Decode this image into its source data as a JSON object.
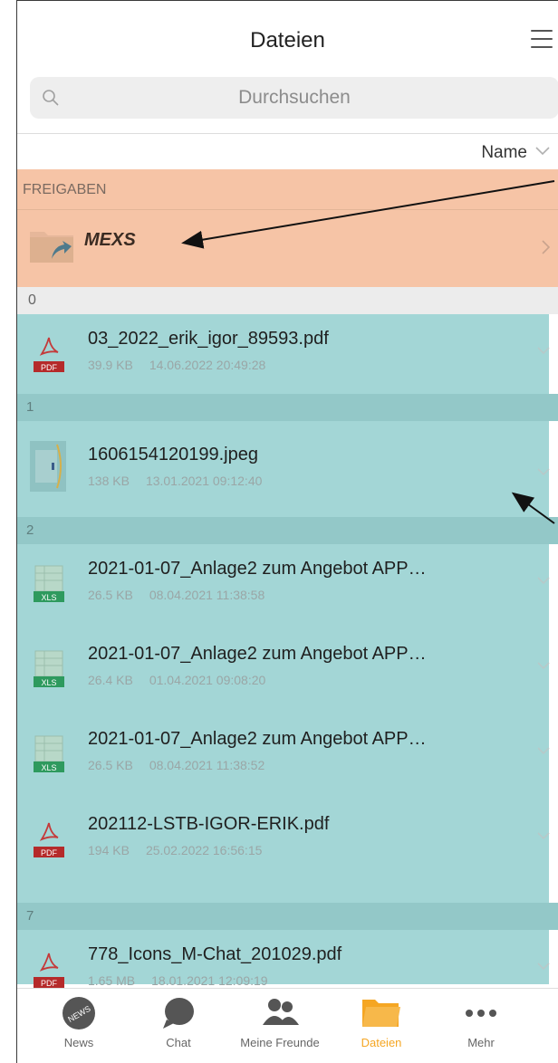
{
  "header": {
    "title": "Dateien"
  },
  "search": {
    "placeholder": "Durchsuchen"
  },
  "sort": {
    "label": "Name"
  },
  "shares": {
    "section_label": "FREIGABEN",
    "items": [
      {
        "label": "MEXS"
      }
    ]
  },
  "groups": [
    {
      "label": "0",
      "files": [
        {
          "name": "03_2022_erik_igor_89593.pdf",
          "size": "39.9 KB",
          "date": "14.06.2022 20:49:28",
          "type": "pdf"
        }
      ]
    },
    {
      "label": "1",
      "files": [
        {
          "name": "1606154120199.jpeg",
          "size": "138 KB",
          "date": "13.01.2021 09:12:40",
          "type": "jpeg"
        }
      ]
    },
    {
      "label": "2",
      "files": [
        {
          "name": "2021-01-07_Anlage2 zum Angebot APP…",
          "size": "26.5 KB",
          "date": "08.04.2021 11:38:58",
          "type": "xls"
        },
        {
          "name": "2021-01-07_Anlage2 zum Angebot APP…",
          "size": "26.4 KB",
          "date": "01.04.2021 09:08:20",
          "type": "xls"
        },
        {
          "name": "2021-01-07_Anlage2 zum Angebot APP…",
          "size": "26.5 KB",
          "date": "08.04.2021 11:38:52",
          "type": "xls"
        },
        {
          "name": "202112-LSTB-IGOR-ERIK.pdf",
          "size": "194 KB",
          "date": "25.02.2022 16:56:15",
          "type": "pdf"
        }
      ]
    },
    {
      "label": "7",
      "files": [
        {
          "name": "778_Icons_M-Chat_201029.pdf",
          "size": "1.65 MB",
          "date": "18.01.2021 12:09:19",
          "type": "pdf"
        }
      ]
    }
  ],
  "tabbar": {
    "tabs": [
      {
        "label": "News",
        "icon": "news-icon"
      },
      {
        "label": "Chat",
        "icon": "chat-bubble-icon"
      },
      {
        "label": "Meine Freunde",
        "icon": "people-icon"
      },
      {
        "label": "Dateien",
        "icon": "folder-icon",
        "active": true
      },
      {
        "label": "Mehr",
        "icon": "more-dots-icon"
      }
    ]
  },
  "colors": {
    "accent": "#f5a623",
    "highlight_orange": "#f6c4a6",
    "highlight_teal": "#a3d6d6"
  },
  "badges": {
    "pdf": "PDF",
    "xls": "XLS",
    "news": "NEWS"
  }
}
